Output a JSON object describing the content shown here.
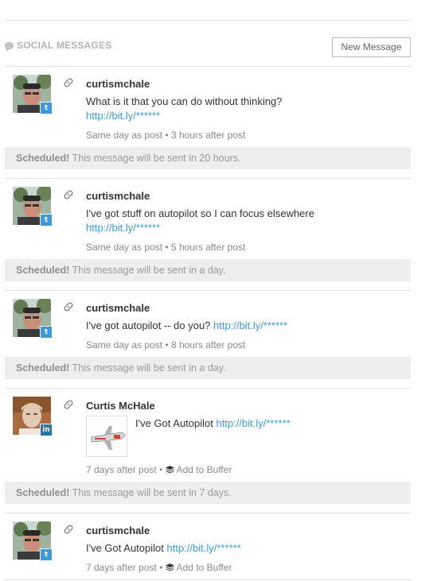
{
  "header": {
    "title": "SOCIAL MESSAGES",
    "new_message_label": "New Message",
    "title_icon": "speech-bubble-icon"
  },
  "messages": [
    {
      "network": "twitter",
      "author": "curtismchale",
      "text": "What is it that you can do without thinking?",
      "link": "http://bit.ly/******",
      "timing": "Same day as post",
      "delay": "3 hours after post",
      "scheduled_label": "Scheduled!",
      "scheduled_text": "This message will be sent in 20 hours."
    },
    {
      "network": "twitter",
      "author": "curtismchale",
      "text": "I've got stuff on autopilot so I can focus elsewhere",
      "link": "http://bit.ly/******",
      "timing": "Same day as post",
      "delay": "5 hours after post",
      "scheduled_label": "Scheduled!",
      "scheduled_text": "This message will be sent in a day."
    },
    {
      "network": "twitter",
      "author": "curtismchale",
      "text": "I've got autopilot -- do you?",
      "link": "http://bit.ly/******",
      "timing": "Same day as post",
      "delay": "8 hours after post",
      "scheduled_label": "Scheduled!",
      "scheduled_text": "This message will be sent in a day."
    },
    {
      "network": "linkedin",
      "author": "Curtis McHale",
      "text": "I've Got Autopilot",
      "link": "http://bit.ly/******",
      "timing": "7 days after post",
      "buffer_label": "Add to Buffer",
      "scheduled_label": "Scheduled!",
      "scheduled_text": "This message will be sent in 7 days."
    },
    {
      "network": "twitter",
      "author": "curtismchale",
      "text": "I've Got Autopilot",
      "link": "http://bit.ly/******",
      "timing": "7 days after post",
      "buffer_label": "Add to Buffer"
    }
  ],
  "separator": "•",
  "colors": {
    "link": "#3d9ad8",
    "twitter": "#3d9ad8",
    "linkedin": "#2b73a8",
    "scheduled_bg": "#eeeeee"
  }
}
